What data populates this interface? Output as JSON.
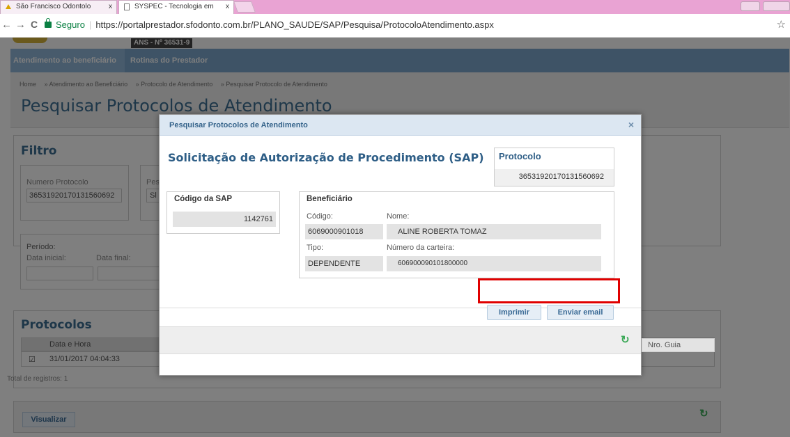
{
  "browser": {
    "tabs": [
      {
        "title": "São Francisco Odontolo",
        "close": "x"
      },
      {
        "title": "SYSPEC - Tecnologia em",
        "close": "x"
      }
    ],
    "secure_label": "Seguro",
    "url": "https://portalprestador.sfodonto.com.br/PLANO_SAUDE/SAP/Pesquisa/ProtocoloAtendimento.aspx",
    "back": "←",
    "forward": "→",
    "reload": "C",
    "star": "☆"
  },
  "header": {
    "ans": "ANS - Nº 36531-9",
    "nav": [
      "Atendimento ao beneficiário",
      "Rotinas do Prestador"
    ]
  },
  "breadcrumb": [
    "Home",
    "» Atendimento ao Beneficiário",
    "» Protocolo de Atendimento",
    "» Pesquisar Protocolo de Atendimento"
  ],
  "page_title": "Pesquisar Protocolos de Atendimento",
  "filter": {
    "title": "Filtro",
    "protocol_label": "Numero Protocolo",
    "protocol_value": "36531920170131560692",
    "pes_label": "Pes",
    "pes_value": "Sl",
    "period_label": "Período:",
    "start_label": "Data inicial:",
    "end_label": "Data final:"
  },
  "protocols": {
    "title": "Protocolos",
    "columns": [
      "Data e Hora",
      "Nro. Guia"
    ],
    "rows": [
      {
        "datetime": "31/01/2017 04:04:33"
      }
    ],
    "total": "Total de registros: 1"
  },
  "view_button": "Visualizar",
  "modal": {
    "title": "Pesquisar Protocolos de Atendimento",
    "close": "×",
    "heading": "Solicitação de Autorização de Procedimento (SAP)",
    "protocol_title": "Protocolo",
    "protocol_value": "36531920170131560692",
    "sap_title": "Código da SAP",
    "sap_value": "1142761",
    "beneficiary_title": "Beneficiário",
    "code_label": "Código:",
    "code_value": "6069000901018",
    "name_label": "Nome:",
    "name_value": "ALINE ROBERTA TOMAZ",
    "type_label": "Tipo:",
    "type_value": "DEPENDENTE",
    "card_label": "Número da carteira:",
    "card_value": "606900090101800000",
    "print_button": "Imprimir",
    "email_button": "Enviar email"
  },
  "refresh_icon_glyph": "↻"
}
